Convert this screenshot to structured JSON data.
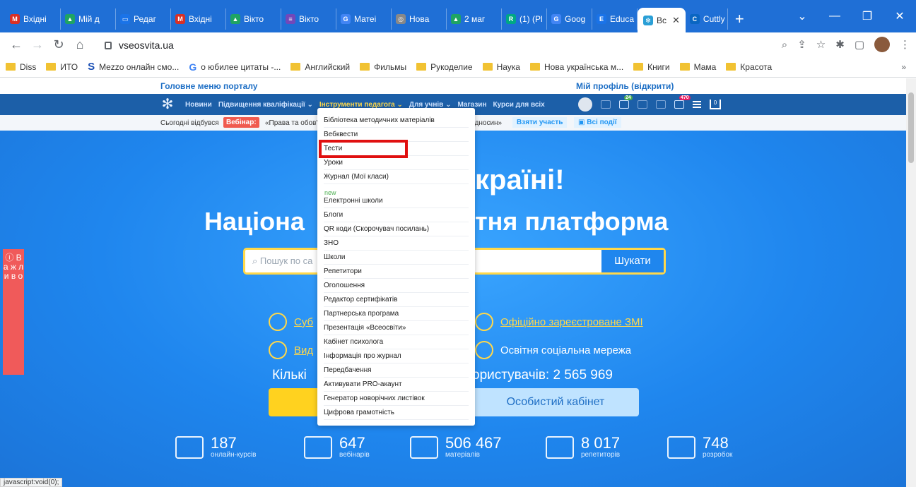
{
  "browser": {
    "tabs": [
      {
        "label": "Вхідні",
        "fav": "M",
        "color": "#d93025"
      },
      {
        "label": "Мій д",
        "fav": "▲",
        "color": "#1fa463"
      },
      {
        "label": "Редаг",
        "fav": "▭",
        "color": "#1a73e8"
      },
      {
        "label": "Вхідні",
        "fav": "M",
        "color": "#d93025"
      },
      {
        "label": "Вікто",
        "fav": "▲",
        "color": "#1fa463"
      },
      {
        "label": "Вікто",
        "fav": "≡",
        "color": "#7248b9"
      },
      {
        "label": "Матеі",
        "fav": "G",
        "color": "#4285f4"
      },
      {
        "label": "Нова",
        "fav": "◎",
        "color": "#888888"
      },
      {
        "label": "2 маг",
        "fav": "▲",
        "color": "#1fa463"
      },
      {
        "label": "(1) (Pl",
        "fav": "R",
        "color": "#00a884"
      },
      {
        "label": "Goog",
        "fav": "G",
        "color": "#4285f4"
      },
      {
        "label": "Educa",
        "fav": "E",
        "color": "#1a73e8"
      }
    ],
    "active_tab": "Вс",
    "extra_tab": "Cuttly",
    "new_tab": "+",
    "url": "vseosvita.ua",
    "bookmarks": [
      {
        "label": "Diss",
        "kind": "folder"
      },
      {
        "label": "ИТО",
        "kind": "folder"
      },
      {
        "label": "Mezzo онлайн смо...",
        "kind": "s-icon"
      },
      {
        "label": "о юбилее цитаты -...",
        "kind": "g-icon"
      },
      {
        "label": "Английский",
        "kind": "folder"
      },
      {
        "label": "Фильмы",
        "kind": "folder"
      },
      {
        "label": "Рукоделие",
        "kind": "folder"
      },
      {
        "label": "Наука",
        "kind": "folder"
      },
      {
        "label": "Нова українська м...",
        "kind": "folder"
      },
      {
        "label": "Книги",
        "kind": "folder"
      },
      {
        "label": "Мама",
        "kind": "folder"
      },
      {
        "label": "Красота",
        "kind": "folder"
      }
    ],
    "bookmarks_more": "»"
  },
  "site": {
    "portal_menu": "Головне меню порталу",
    "profile": "Мій профіль (відкрити)",
    "nav": {
      "news": "Новини",
      "qualification": "Підвищення кваліфікації ⌄",
      "teacher_tools": "Інструменти педагога ⌄",
      "students": "Для учнів ⌄",
      "shop": "Магазин",
      "courses": "Курси для всіх"
    },
    "badges": {
      "messages": "24",
      "bell": "470",
      "cart": "0"
    },
    "event": {
      "today": "Сьогодні відбувся",
      "webinar": "Вебінар:",
      "topic": "«Права та обов'",
      "topic_end": "відносин»",
      "join": "Взяти участь",
      "all": "Всі події"
    },
    "hero": {
      "title_end": "країні!",
      "subtitle_start": "Націона",
      "subtitle_end": "тня платформа",
      "search_placeholder": "Пошук по са",
      "search_button": "Шукати",
      "feat1": "Суб",
      "feat2": "Офіційно зареєстроване ЗМІ",
      "feat3": "Вид",
      "feat4": "Освітня соціальна мережа",
      "count_start": "Кількі",
      "count_end": "ористувачів: 2 565 969",
      "cabinet": "Особистий кабінет"
    },
    "stats": [
      {
        "num": "187",
        "label": "онлайн-курсів"
      },
      {
        "num": "647",
        "label": "вебінарів"
      },
      {
        "num": "506 467",
        "label": "матеріалів"
      },
      {
        "num": "8 017",
        "label": "репетиторів"
      },
      {
        "num": "748",
        "label": "розробок"
      }
    ],
    "side_tab": "ⓘ В а ж л и в о"
  },
  "dropdown": {
    "items": [
      "Бібліотека методичних матеріалів",
      "Вебквести",
      "Тести",
      "Уроки",
      "Журнал (Мої класи)",
      "Електронні школи",
      "Блоги",
      "QR коди (Скорочувач посилань)",
      "ЗНО",
      "Школи",
      "Репетитори",
      "Оголошення",
      "Редактор сертифікатів",
      "Партнерська програма",
      "Презентація «Всеосвіти»",
      "Кабінет психолога",
      "Інформація про журнал",
      "Передбачення",
      "Активувати PRO-акаунт",
      "Генератор новорічних листівок",
      "Цифрова грамотність"
    ],
    "new_label": "new",
    "highlighted": "Тести"
  },
  "status": "javascript:void(0);"
}
